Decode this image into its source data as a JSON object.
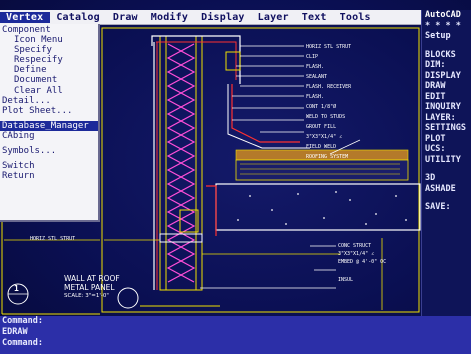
{
  "menubar": {
    "items": [
      "Vertex",
      "Catalog",
      "Draw",
      "Modify",
      "Display",
      "Layer",
      "Text",
      "Tools"
    ]
  },
  "dropdown": {
    "items": [
      {
        "label": "Component",
        "indent": false
      },
      {
        "label": "Icon Menu",
        "indent": true
      },
      {
        "label": "Specify",
        "indent": true
      },
      {
        "label": "Respecify",
        "indent": true
      },
      {
        "label": "Define",
        "indent": true
      },
      {
        "label": "Document",
        "indent": true
      },
      {
        "label": "Clear All",
        "indent": true
      },
      {
        "label": "Detail...",
        "indent": false
      },
      {
        "label": "Plot Sheet...",
        "indent": false
      }
    ],
    "selected": "Database_Manager",
    "items2": [
      "CAbing"
    ],
    "items3": [
      "Symbols..."
    ],
    "items4": [
      "Switch",
      "Return"
    ]
  },
  "sidemenu": {
    "title": "AutoCAD",
    "stars": "* * * *",
    "setup": "Setup",
    "items": [
      "BLOCKS",
      "DIM:",
      "DISPLAY",
      "DRAW",
      "EDIT",
      "INQUIRY",
      "LAYER:",
      "SETTINGS",
      "PLOT",
      "UCS:",
      "UTILITY"
    ],
    "items2": [
      "3D",
      "ASHADE"
    ],
    "save": "SAVE:"
  },
  "drawing": {
    "labels": {
      "strut": "HORIZ STL STRUT",
      "clip": "CLIP",
      "flash": "FLASH.",
      "sealant": "SEALANT",
      "receiver": "FLASH. RECEIVER",
      "flash2": "FLASH.",
      "cont": "CONT 1/8\"Ø",
      "weld": "WELD TO STUDS",
      "grout": "GROUT FILL",
      "angle": "3\"X3\"X1/4\" ∠",
      "field": "FIELD WELD",
      "roofing": "ROOFING SYSTEM",
      "conc": "CONC STRUCT",
      "angle2": "3\"X3\"X1/4\" ∠",
      "embed": "EMBED @ 4'-0\" OC",
      "insul": "INSUL",
      "horiz2": "HORIZ STL STRUT",
      "title1": "WALL AT ROOF",
      "title2": "METAL PANEL",
      "scale": "SCALE: 3\"=1'-0\"",
      "number": "1"
    }
  },
  "commandline": {
    "lines": [
      "Command:",
      "EDRAW",
      "Command:"
    ]
  },
  "colors": {
    "accent": "#1c2a9a",
    "drawing_yellow": "#f0e000",
    "drawing_red": "#ff3030",
    "drawing_white": "#ffffff",
    "drawing_magenta": "#ff40ff"
  }
}
